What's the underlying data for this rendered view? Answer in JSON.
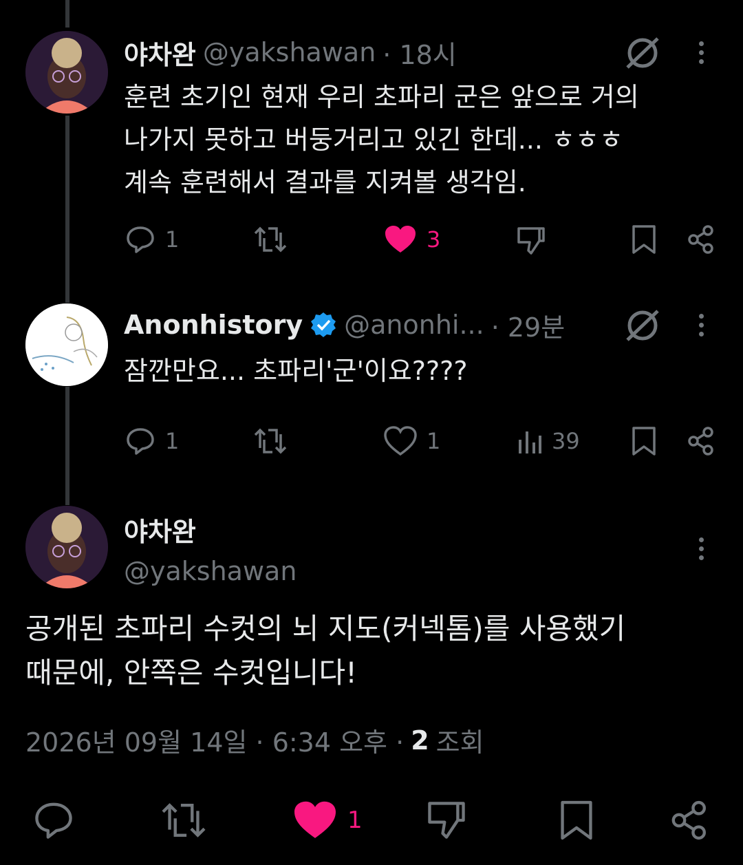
{
  "tweet1": {
    "name": "야차완",
    "handle": "@yakshawan",
    "time": "· 18시",
    "lines": [
      "훈련 초기인 현재 우리 초파리 군은 앞으로 거의",
      "나가지 못하고 버둥거리고 있긴 한데... ㅎㅎㅎ",
      "계속 훈련해서 결과를 지켜볼 생각임."
    ],
    "replies": "1",
    "likes": "3"
  },
  "tweet2": {
    "name": "Anonhistory",
    "handle": "@anonhi...",
    "time": "· 29분",
    "text": "잠깐만요... 초파리'군'이요????",
    "replies": "1",
    "likes": "1",
    "views": "39"
  },
  "main": {
    "name": "야차완",
    "handle": "@yakshawan",
    "lines": [
      "공개된 초파리 수컷의 뇌 지도(커넥톰)를 사용했기",
      "때문에, 안쪽은 수컷입니다!"
    ],
    "date": "2026년 09월 14일 · 6:34 오후 ·",
    "views_count": "2",
    "views_label": "조회",
    "likes": "1"
  },
  "colors": {
    "background": "#000000",
    "text": "#e7e9ea",
    "muted": "#71767b",
    "like": "#f91880",
    "verified": "#1d9bf0",
    "thread_line": "#333639"
  },
  "icons": [
    "grok-icon",
    "more-icon",
    "reply-icon",
    "retweet-icon",
    "heart-icon",
    "dislike-icon",
    "bookmark-icon",
    "share-icon",
    "views-icon",
    "verified-badge-icon"
  ]
}
